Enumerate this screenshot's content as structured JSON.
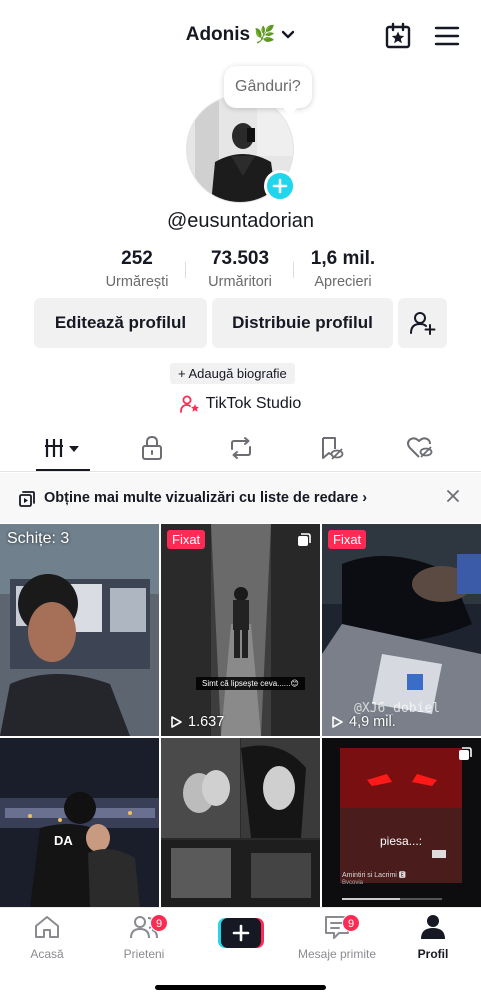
{
  "header": {
    "username": "Adonis",
    "emoji": "🌿"
  },
  "profile": {
    "thought_placeholder": "Gânduri?",
    "handle": "@eusuntadorian",
    "stats": [
      {
        "value": "252",
        "label": "Urmărești"
      },
      {
        "value": "73.503",
        "label": "Urmăritori"
      },
      {
        "value": "1,6 mil.",
        "label": "Aprecieri"
      }
    ],
    "buttons": {
      "edit": "Editează profilul",
      "share": "Distribuie profilul"
    },
    "bio_chip": "+ Adaugă biografie",
    "studio": "TikTok Studio"
  },
  "playlist_banner": {
    "text": "Obține mai multe vizualizări cu liste de redare ›"
  },
  "grid": {
    "drafts": "Schițe: 3",
    "items": [
      {
        "pinned_label": "Fixat",
        "views": "1.637",
        "caption": "Simt că lipsește ceva......😊"
      },
      {
        "pinned_label": "Fixat",
        "views": "4,9 mil.",
        "watermark": "@XJ6_dobiel"
      },
      {
        "jersey_text": "DA"
      },
      {},
      {
        "song_title": "piesa...:",
        "song_line1": "Amintiri si Lacrimi 🅴",
        "song_line2": "Bvcovia"
      }
    ]
  },
  "bottom_nav": {
    "items": [
      {
        "label": "Acasă"
      },
      {
        "label": "Prieteni",
        "badge": "9"
      },
      {
        "label": "Mesaje primite",
        "badge": "9"
      },
      {
        "label": "Profil"
      }
    ]
  },
  "colors": {
    "accent_red": "#fe2c55",
    "accent_cyan": "#20d5ec",
    "text": "#161823",
    "secondary_text": "#6a6a6a",
    "button_bg": "#f1f1f2"
  }
}
